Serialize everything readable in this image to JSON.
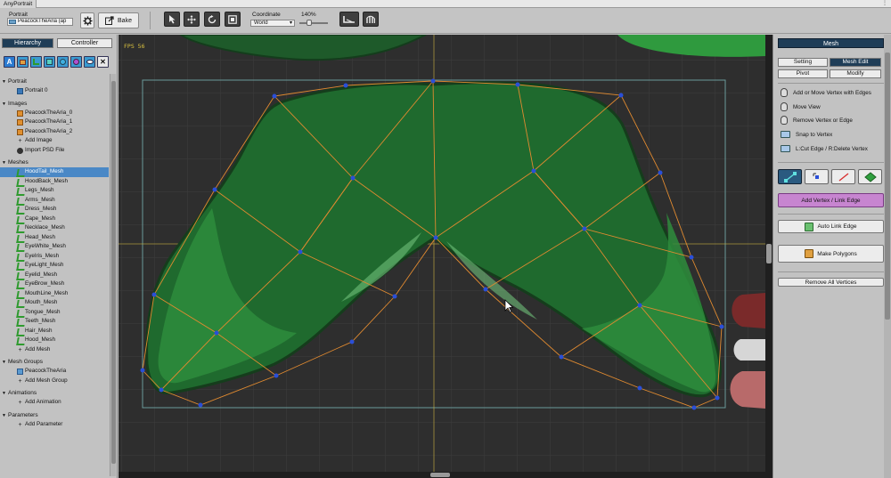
{
  "window": {
    "title": "AnyPortrait"
  },
  "toolbar": {
    "portrait_label": "Portrait",
    "portrait_value": "PeacockTheAria (ap",
    "bake_label": "Bake",
    "coordinate_label": "Coordinate",
    "coordinate_value": "World",
    "zoom_value": "140%"
  },
  "left_panel": {
    "tabs": [
      "Hierarchy",
      "Controller"
    ],
    "filter_buttons": [
      "A",
      "img",
      "mesh",
      "grp",
      "anim",
      "param",
      "vis",
      "x"
    ],
    "sections": [
      {
        "title": "Portrait",
        "items": [
          {
            "label": "Portrait 0",
            "icon": "portrait-icon"
          }
        ]
      },
      {
        "title": "Images",
        "items": [
          {
            "label": "PeacockTheAria_0",
            "icon": "image-icon"
          },
          {
            "label": "PeacockTheAria_1",
            "icon": "image-icon"
          },
          {
            "label": "PeacockTheAria_2",
            "icon": "image-icon"
          },
          {
            "label": "Add Image",
            "icon": "add-icon"
          },
          {
            "label": "Import PSD File",
            "icon": "psd-icon"
          }
        ]
      },
      {
        "title": "Meshes",
        "items": [
          {
            "label": "HoodTail_Mesh",
            "icon": "mesh-icon",
            "selected": true
          },
          {
            "label": "HoodBack_Mesh",
            "icon": "mesh-icon"
          },
          {
            "label": "Legs_Mesh",
            "icon": "mesh-icon"
          },
          {
            "label": "Arms_Mesh",
            "icon": "mesh-icon"
          },
          {
            "label": "Dress_Mesh",
            "icon": "mesh-icon"
          },
          {
            "label": "Cape_Mesh",
            "icon": "mesh-icon"
          },
          {
            "label": "Necklace_Mesh",
            "icon": "mesh-icon"
          },
          {
            "label": "Head_Mesh",
            "icon": "mesh-icon"
          },
          {
            "label": "EyeWhite_Mesh",
            "icon": "mesh-icon"
          },
          {
            "label": "EyeIris_Mesh",
            "icon": "mesh-icon"
          },
          {
            "label": "EyeLight_Mesh",
            "icon": "mesh-icon"
          },
          {
            "label": "Eyelid_Mesh",
            "icon": "mesh-icon"
          },
          {
            "label": "EyeBrow_Mesh",
            "icon": "mesh-icon"
          },
          {
            "label": "MouthLine_Mesh",
            "icon": "mesh-icon"
          },
          {
            "label": "Mouth_Mesh",
            "icon": "mesh-icon"
          },
          {
            "label": "Tongue_Mesh",
            "icon": "mesh-icon"
          },
          {
            "label": "Teeth_Mesh",
            "icon": "mesh-icon"
          },
          {
            "label": "Hair_Mesh",
            "icon": "mesh-icon"
          },
          {
            "label": "Hood_Mesh",
            "icon": "mesh-icon"
          },
          {
            "label": "Add Mesh",
            "icon": "add-icon"
          }
        ]
      },
      {
        "title": "Mesh Groups",
        "items": [
          {
            "label": "PeacockTheAria",
            "icon": "mesh-group-icon"
          },
          {
            "label": "Add Mesh Group",
            "icon": "add-icon"
          }
        ]
      },
      {
        "title": "Animations",
        "items": [
          {
            "label": "Add Animation",
            "icon": "add-icon"
          }
        ]
      },
      {
        "title": "Parameters",
        "items": [
          {
            "label": "Add Parameter",
            "icon": "add-icon"
          }
        ]
      }
    ]
  },
  "viewport": {
    "fps": "FPS 56"
  },
  "right_panel": {
    "title": "Mesh",
    "tabs_row1": [
      "Setting",
      "Mesh Edit"
    ],
    "tabs_row2": [
      "Pivot",
      "Modify"
    ],
    "hints": [
      {
        "label": "Add or Move Vertex with Edges",
        "icon": "mouse-left-icon"
      },
      {
        "label": "Move View",
        "icon": "mouse-middle-icon"
      },
      {
        "label": "Remove Vertex or Edge",
        "icon": "mouse-right-icon"
      },
      {
        "label": "Snap to Vertex",
        "icon": "keyboard-icon"
      },
      {
        "label": "L:Cut Edge / R:Delete Vertex",
        "icon": "keyboard-icon"
      }
    ],
    "add_vertex_label": "Add Vertex / Link Edge",
    "auto_link_label": "Auto Link Edge",
    "make_polygons_label": "Make Polygons",
    "remove_all_label": "Remove All Vertices"
  },
  "colors": {
    "accent_dark": "#1f3d57",
    "selected_row": "#4a88c6",
    "mesh_green": "#2b8a3e",
    "edge_orange": "#e08a30",
    "vertex_blue": "#2a4fd8",
    "add_vertex_pink": "#c785d0"
  }
}
